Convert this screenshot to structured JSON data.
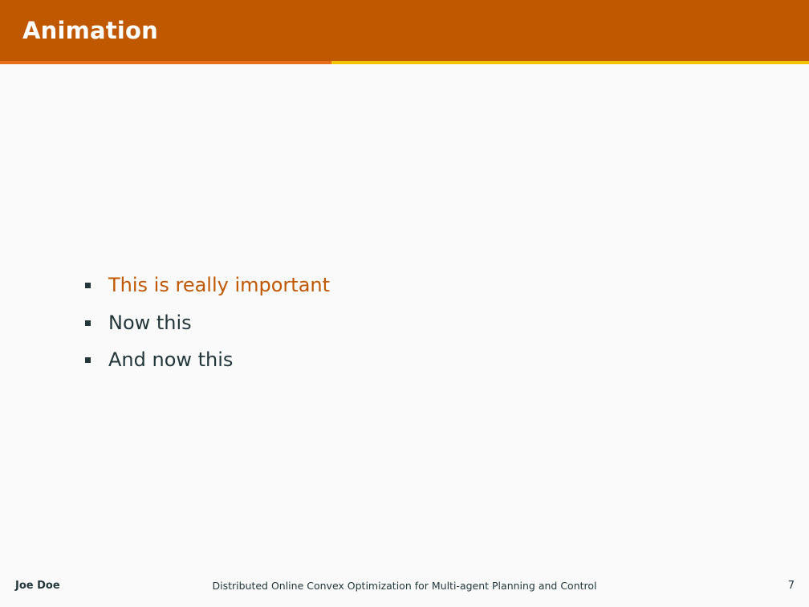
{
  "slide": {
    "title": "Animation",
    "progress": 0.41
  },
  "content": {
    "items": [
      {
        "text": "This is really important",
        "highlighted": true
      },
      {
        "text": "Now this",
        "highlighted": false
      },
      {
        "text": "And now this",
        "highlighted": false
      }
    ]
  },
  "footer": {
    "author": "Joe Doe",
    "title": "Distributed Online Convex Optimization for Multi-agent Planning and Control",
    "page_number": "7"
  },
  "colors": {
    "title_bar": "#c05800",
    "alert_text": "#c05800",
    "progress_fill": "#e8701a",
    "progress_track": "#f5c400",
    "body_text": "#23373b",
    "background": "#fafafa"
  }
}
